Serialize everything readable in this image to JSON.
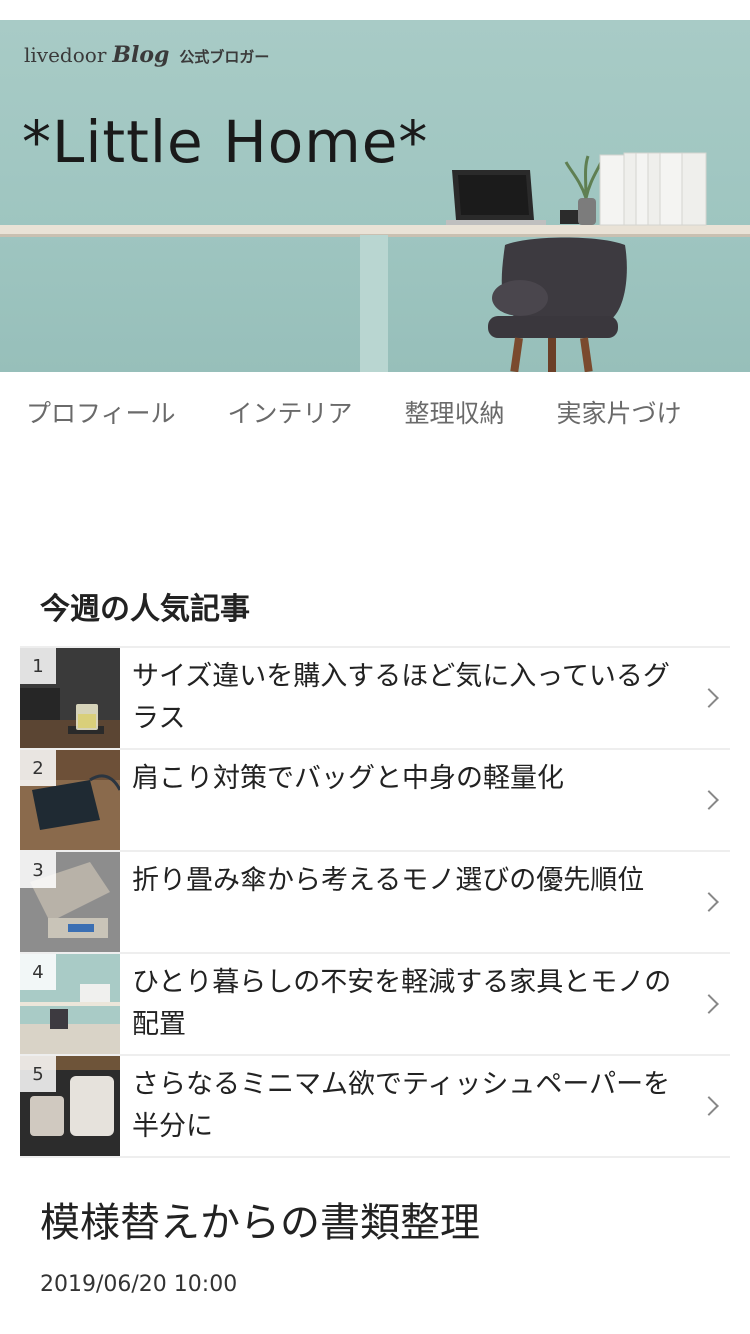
{
  "header": {
    "brand_livedoor": "livedoor",
    "brand_blog": "Blog",
    "brand_official": "公式ブロガー",
    "blog_title": "*Little Home*"
  },
  "nav": {
    "items": [
      {
        "label": "プロフィール"
      },
      {
        "label": "インテリア"
      },
      {
        "label": "整理収納"
      },
      {
        "label": "実家片づけ"
      }
    ]
  },
  "popular": {
    "heading": "今週の人気記事",
    "items": [
      {
        "rank": "1",
        "title": "サイズ違いを購入するほど気に入っているグラス"
      },
      {
        "rank": "2",
        "title": "肩こり対策でバッグと中身の軽量化"
      },
      {
        "rank": "3",
        "title": "折り畳み傘から考えるモノ選びの優先順位"
      },
      {
        "rank": "4",
        "title": "ひとり暮らしの不安を軽減する家具とモノの配置"
      },
      {
        "rank": "5",
        "title": "さらなるミニマム欲でティッシュペーパーを半分に"
      }
    ]
  },
  "article": {
    "title": "模様替えからの書類整理",
    "date": "2019/06/20 10:00"
  },
  "colors": {
    "hero_bg": "#a8cbc6",
    "nav_text": "#6a6a6a",
    "divider": "#eeeeee"
  }
}
